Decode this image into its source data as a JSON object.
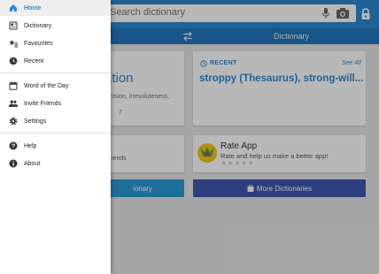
{
  "header": {
    "search_placeholder": "Search dictionary",
    "tabs": {
      "right_label": "Dictionary"
    }
  },
  "cards": {
    "left": {
      "title_fragment": "ation",
      "subtitle_fragment": "ecision, irresoluteness,",
      "number_fragment": "7"
    },
    "recent": {
      "label": "RECENT",
      "see_all": "See All",
      "word": "stroppy (Thesaurus), strong-will..."
    },
    "friends": {
      "text_fragment": "iends"
    },
    "rate": {
      "title": "Rate App",
      "subtitle": "Rate and help us make a better app!",
      "stars": "★★★★★"
    }
  },
  "buttons": {
    "left_label_fragment": "ionary",
    "more_label": "More Dictionaries"
  },
  "drawer": {
    "items": [
      {
        "label": "Home",
        "icon": "home-icon",
        "active": true
      },
      {
        "label": "Dictionary",
        "icon": "dictionary-icon"
      },
      {
        "label": "Favourites",
        "icon": "favourites-icon"
      },
      {
        "label": "Recent",
        "icon": "clock-icon"
      },
      {
        "label": "Word of the Day",
        "icon": "calendar-icon"
      },
      {
        "label": "Invite Friends",
        "icon": "people-icon"
      },
      {
        "label": "Settings",
        "icon": "gear-icon"
      },
      {
        "label": "Help",
        "icon": "help-icon"
      },
      {
        "label": "About",
        "icon": "info-icon"
      }
    ]
  },
  "colors": {
    "primary": "#2d88cf",
    "tabbar": "#2176bd",
    "button_more": "#3f58b1",
    "button_left": "#2b9ad9"
  }
}
